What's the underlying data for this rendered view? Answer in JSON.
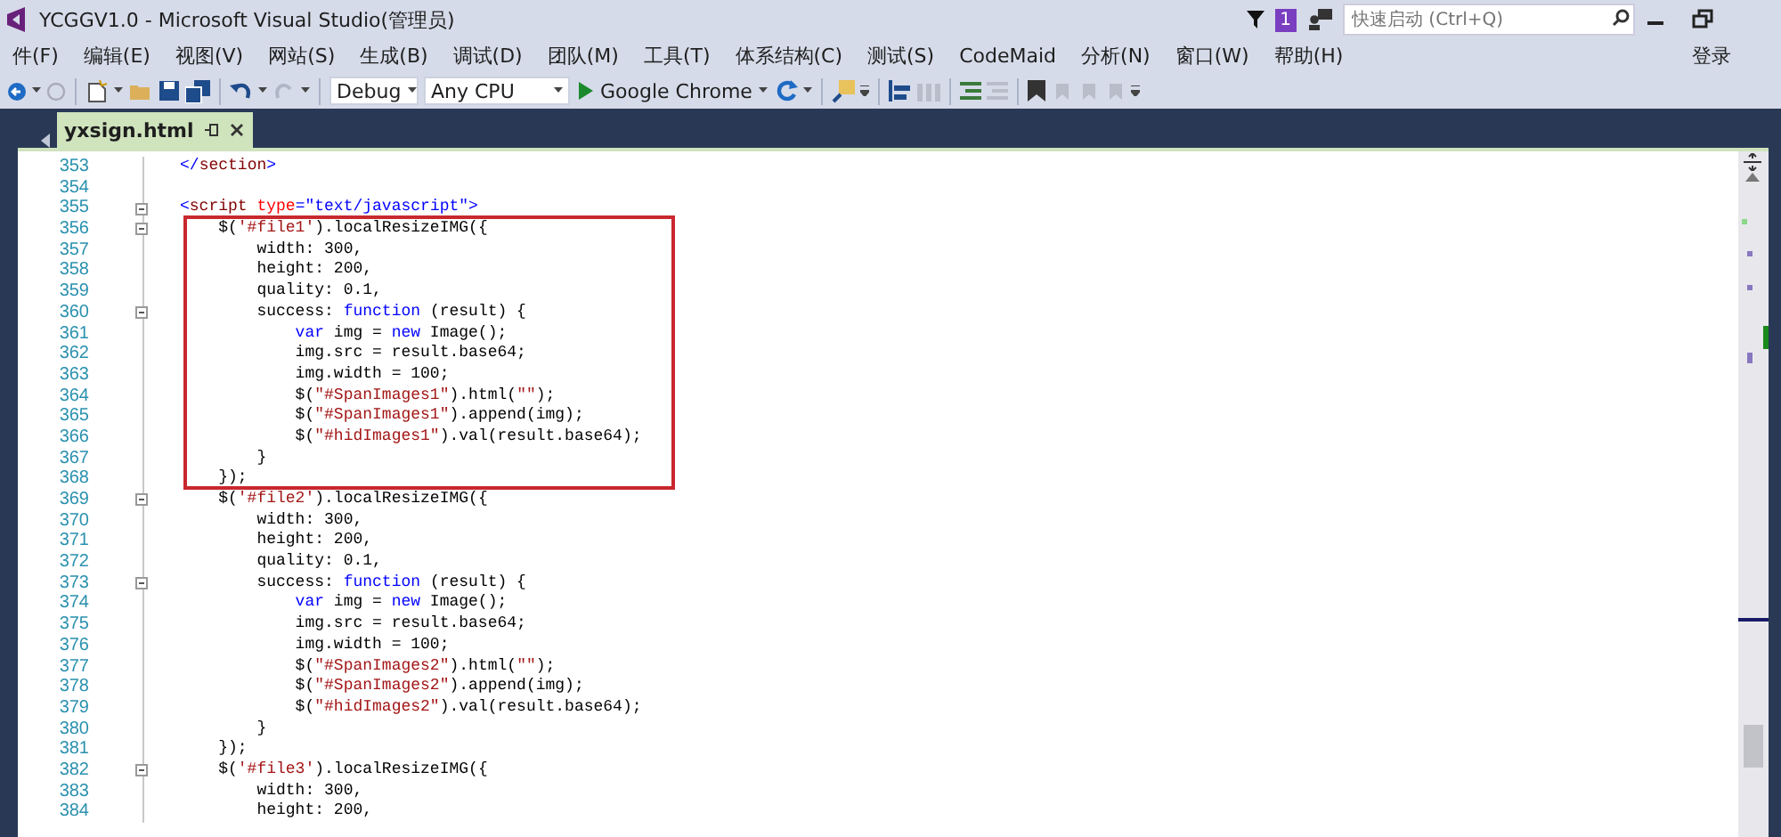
{
  "window": {
    "title": "YCGGV1.0 - Microsoft Visual Studio(管理员)",
    "notification_count": "1",
    "quick_launch": {
      "placeholder": "快速启动 (Ctrl+Q)"
    }
  },
  "menu": {
    "items": [
      "件(F)",
      "编辑(E)",
      "视图(V)",
      "网站(S)",
      "生成(B)",
      "调试(D)",
      "团队(M)",
      "工具(T)",
      "体系结构(C)",
      "测试(S)",
      "CodeMaid",
      "分析(N)",
      "窗口(W)",
      "帮助(H)"
    ],
    "sign_in": "登录"
  },
  "toolbar": {
    "configuration": "Debug",
    "platform": "Any CPU",
    "run_target": "Google Chrome"
  },
  "tabs": [
    {
      "label": "yxsign.html",
      "selected": true
    }
  ],
  "editor": {
    "sections": [
      {
        "highlighted": false,
        "lines": [
          {
            "number": "353",
            "fold": false,
            "tokens": [
              {
                "kind": "delim",
                "text": "</"
              },
              {
                "kind": "tag",
                "text": "section"
              },
              {
                "kind": "delim",
                "text": ">"
              }
            ]
          },
          {
            "number": "354",
            "fold": false
          },
          {
            "number": "355",
            "fold": true,
            "tokens": [
              {
                "kind": "delim",
                "text": "<"
              },
              {
                "kind": "tag",
                "text": "script"
              },
              {
                "kind": "attr",
                "text": " type"
              },
              {
                "kind": "delim",
                "text": "=\"text/javascript\">"
              }
            ]
          }
        ]
      },
      {
        "highlighted": true,
        "lines": [
          {
            "number": "356",
            "fold": true,
            "tokens": [
              {
                "kind": "plain",
                "text": "    $("
              },
              {
                "kind": "string",
                "text": "'#file1'"
              },
              {
                "kind": "plain",
                "text": ").localResizeIMG({"
              }
            ]
          },
          {
            "number": "357",
            "fold": false,
            "tokens": [
              {
                "kind": "plain",
                "text": "        width: 300,"
              }
            ]
          },
          {
            "number": "358",
            "fold": false,
            "tokens": [
              {
                "kind": "plain",
                "text": "        height: 200,"
              }
            ]
          },
          {
            "number": "359",
            "fold": false,
            "tokens": [
              {
                "kind": "plain",
                "text": "        quality: 0.1,"
              }
            ]
          },
          {
            "number": "360",
            "fold": true,
            "tokens": [
              {
                "kind": "plain",
                "text": "        success: "
              },
              {
                "kind": "keyword",
                "text": "function"
              },
              {
                "kind": "plain",
                "text": " (result) {"
              }
            ]
          },
          {
            "number": "361",
            "fold": false,
            "tokens": [
              {
                "kind": "keyword",
                "text": "            var"
              },
              {
                "kind": "plain",
                "text": " img = "
              },
              {
                "kind": "keyword",
                "text": "new"
              },
              {
                "kind": "plain",
                "text": " Image();"
              }
            ]
          },
          {
            "number": "362",
            "fold": false,
            "tokens": [
              {
                "kind": "plain",
                "text": "            img.src = result.base64;"
              }
            ]
          },
          {
            "number": "363",
            "fold": false,
            "tokens": [
              {
                "kind": "plain",
                "text": "            img.width = 100;"
              }
            ]
          },
          {
            "number": "364",
            "fold": false,
            "tokens": [
              {
                "kind": "plain",
                "text": "            $("
              },
              {
                "kind": "string",
                "text": "\"#SpanImages1\""
              },
              {
                "kind": "plain",
                "text": ").html("
              },
              {
                "kind": "string",
                "text": "\"\""
              },
              {
                "kind": "plain",
                "text": ");"
              }
            ]
          },
          {
            "number": "365",
            "fold": false,
            "tokens": [
              {
                "kind": "plain",
                "text": "            $("
              },
              {
                "kind": "string",
                "text": "\"#SpanImages1\""
              },
              {
                "kind": "plain",
                "text": ").append(img);"
              }
            ]
          },
          {
            "number": "366",
            "fold": false,
            "tokens": [
              {
                "kind": "plain",
                "text": "            $("
              },
              {
                "kind": "string",
                "text": "\"#hidImages1\""
              },
              {
                "kind": "plain",
                "text": ").val(result.base64);"
              }
            ]
          },
          {
            "number": "367",
            "fold": false,
            "tokens": [
              {
                "kind": "plain",
                "text": "        }"
              }
            ]
          },
          {
            "number": "368",
            "fold": false,
            "tokens": [
              {
                "kind": "plain",
                "text": "    });"
              }
            ]
          }
        ]
      },
      {
        "highlighted": false,
        "lines": [
          {
            "number": "369",
            "fold": true,
            "tokens": [
              {
                "kind": "plain",
                "text": "    $("
              },
              {
                "kind": "string",
                "text": "'#file2'"
              },
              {
                "kind": "plain",
                "text": ").localResizeIMG({"
              }
            ]
          },
          {
            "number": "370",
            "fold": false,
            "tokens": [
              {
                "kind": "plain",
                "text": "        width: 300,"
              }
            ]
          },
          {
            "number": "371",
            "fold": false,
            "tokens": [
              {
                "kind": "plain",
                "text": "        height: 200,"
              }
            ]
          },
          {
            "number": "372",
            "fold": false,
            "tokens": [
              {
                "kind": "plain",
                "text": "        quality: 0.1,"
              }
            ]
          },
          {
            "number": "373",
            "fold": true,
            "tokens": [
              {
                "kind": "plain",
                "text": "        success: "
              },
              {
                "kind": "keyword",
                "text": "function"
              },
              {
                "kind": "plain",
                "text": " (result) {"
              }
            ]
          },
          {
            "number": "374",
            "fold": false,
            "tokens": [
              {
                "kind": "keyword",
                "text": "            var"
              },
              {
                "kind": "plain",
                "text": " img = "
              },
              {
                "kind": "keyword",
                "text": "new"
              },
              {
                "kind": "plain",
                "text": " Image();"
              }
            ]
          },
          {
            "number": "375",
            "fold": false,
            "tokens": [
              {
                "kind": "plain",
                "text": "            img.src = result.base64;"
              }
            ]
          },
          {
            "number": "376",
            "fold": false,
            "tokens": [
              {
                "kind": "plain",
                "text": "            img.width = 100;"
              }
            ]
          },
          {
            "number": "377",
            "fold": false,
            "tokens": [
              {
                "kind": "plain",
                "text": "            $("
              },
              {
                "kind": "string",
                "text": "\"#SpanImages2\""
              },
              {
                "kind": "plain",
                "text": ").html("
              },
              {
                "kind": "string",
                "text": "\"\""
              },
              {
                "kind": "plain",
                "text": ");"
              }
            ]
          },
          {
            "number": "378",
            "fold": false,
            "tokens": [
              {
                "kind": "plain",
                "text": "            $("
              },
              {
                "kind": "string",
                "text": "\"#SpanImages2\""
              },
              {
                "kind": "plain",
                "text": ").append(img);"
              }
            ]
          },
          {
            "number": "379",
            "fold": false,
            "tokens": [
              {
                "kind": "plain",
                "text": "            $("
              },
              {
                "kind": "string",
                "text": "\"#hidImages2\""
              },
              {
                "kind": "plain",
                "text": ").val(result.base64);"
              }
            ]
          },
          {
            "number": "380",
            "fold": false,
            "tokens": [
              {
                "kind": "plain",
                "text": "        }"
              }
            ]
          },
          {
            "number": "381",
            "fold": false,
            "tokens": [
              {
                "kind": "plain",
                "text": "    });"
              }
            ]
          },
          {
            "number": "382",
            "fold": true,
            "tokens": [
              {
                "kind": "plain",
                "text": "    $("
              },
              {
                "kind": "string",
                "text": "'#file3'"
              },
              {
                "kind": "plain",
                "text": ").localResizeIMG({"
              }
            ]
          },
          {
            "number": "383",
            "fold": false,
            "tokens": [
              {
                "kind": "plain",
                "text": "        width: 300,"
              }
            ]
          },
          {
            "number": "384",
            "fold": false,
            "tokens": [
              {
                "kind": "plain",
                "text": "        height: 200,"
              }
            ]
          }
        ]
      }
    ]
  }
}
